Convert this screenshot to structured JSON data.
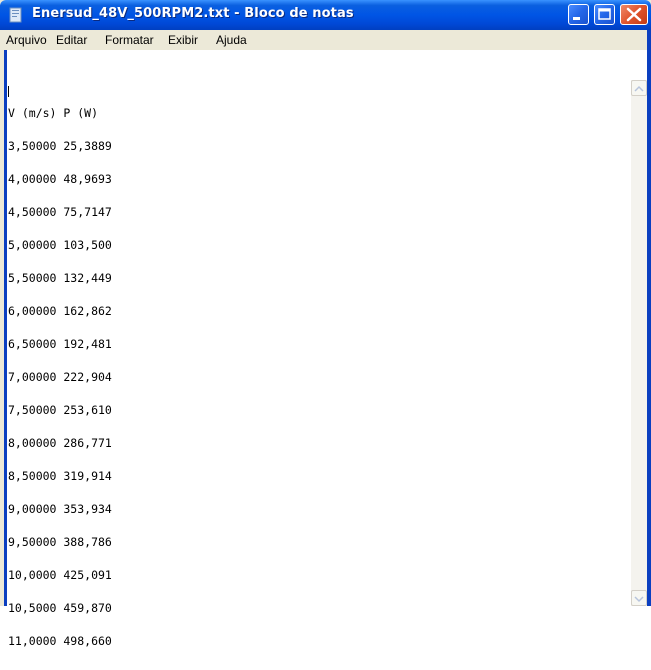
{
  "window": {
    "title": "Enersud_48V_500RPM2.txt - Bloco de notas"
  },
  "menu": [
    {
      "label": "Arquivo"
    },
    {
      "label": "Editar"
    },
    {
      "label": "Formatar"
    },
    {
      "label": "Exibir"
    },
    {
      "label": "Ajuda"
    }
  ],
  "document": {
    "lines": [
      "V (m/s) P (W)",
      "3,50000 25,3889",
      "4,00000 48,9693",
      "4,50000 75,7147",
      "5,00000 103,500",
      "5,50000 132,449",
      "6,00000 162,862",
      "6,50000 192,481",
      "7,00000 222,904",
      "7,50000 253,610",
      "8,00000 286,771",
      "8,50000 319,914",
      "9,00000 353,934",
      "9,50000 388,786",
      "10,0000 425,091",
      "10,5000 459,870",
      "11,0000 498,660"
    ]
  },
  "icons": {
    "app": "notepad-icon",
    "minimize": "minimize-icon",
    "maximize": "maximize-icon",
    "close": "close-icon",
    "scroll_up": "scroll-up-arrow-icon",
    "scroll_down": "scroll-down-arrow-icon"
  },
  "colors": {
    "titlebar": "#0055e5",
    "close_button": "#e0542c",
    "menubar": "#ece9d8"
  }
}
